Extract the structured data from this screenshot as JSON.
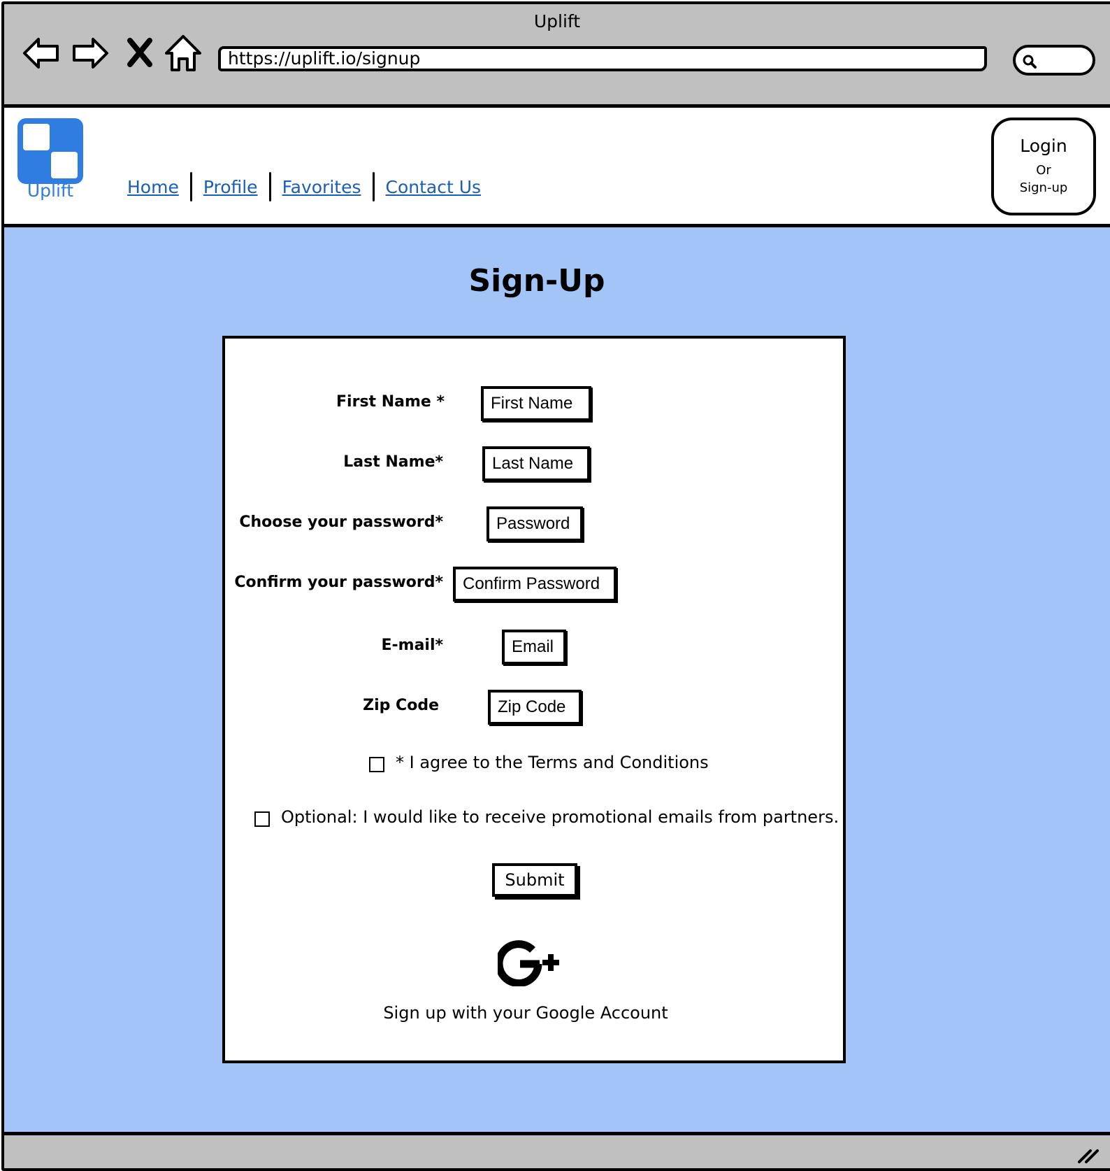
{
  "browser": {
    "window_title": "Uplift",
    "url": "https://uplift.io/signup",
    "icons": [
      "back-arrow-icon",
      "forward-arrow-icon",
      "close-icon",
      "home-icon",
      "search-icon"
    ]
  },
  "header": {
    "logo_text": "Uplift",
    "nav": [
      "Home",
      "Profile",
      "Favorites",
      "Contact Us"
    ],
    "login": {
      "label": "Login",
      "or": "Or",
      "signup": "Sign-up"
    }
  },
  "page": {
    "title": "Sign-Up"
  },
  "form": {
    "first_name": {
      "label": "First Name *",
      "placeholder": "First Name"
    },
    "last_name": {
      "label": "Last Name*",
      "placeholder": "Last Name"
    },
    "password": {
      "label": "Choose your password*",
      "placeholder": "Password"
    },
    "confirm_password": {
      "label": "Confirm your password*",
      "placeholder": "Confirm Password"
    },
    "email": {
      "label": "E-mail*",
      "placeholder": "Email"
    },
    "zip": {
      "label": "Zip Code",
      "placeholder": "Zip Code"
    },
    "terms": "* I agree to the Terms and Conditions",
    "promo": "Optional: I would like to receive promotional emails from partners.",
    "submit": "Submit",
    "google_text": "Sign up with your Google Account"
  },
  "colors": {
    "page_bg": "#a2c4f6",
    "chrome_bg": "#c0c0c0",
    "link": "#1a5fb4",
    "logo": "#2f7de0"
  }
}
